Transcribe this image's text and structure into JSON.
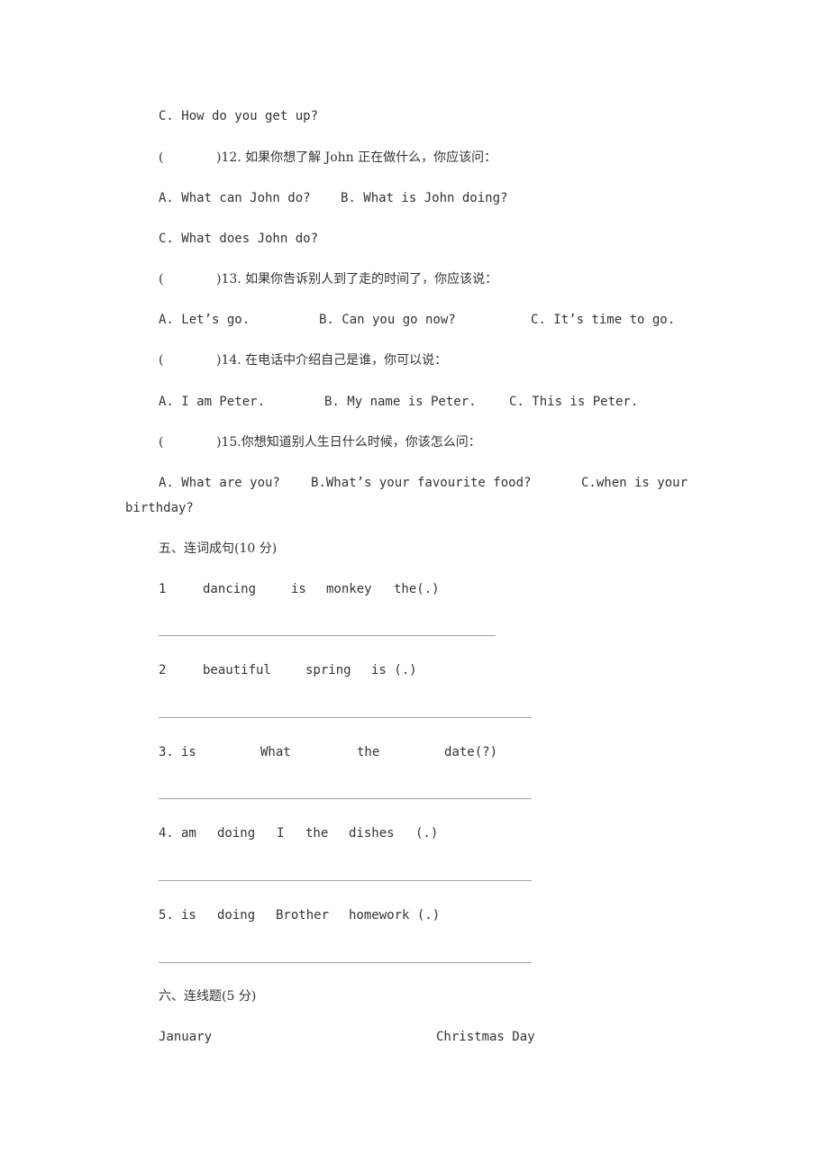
{
  "q11": {
    "option_c": "C. How do you get up?"
  },
  "q12": {
    "bracket_open": "(",
    "stem": ")12. 如果你想了解 John 正在做什么，你应该问：",
    "option_a": "A. What can John do?",
    "option_b": "B. What is John doing?",
    "option_c": "C. What does John do?"
  },
  "q13": {
    "bracket_open": "(",
    "stem": ")13. 如果你告诉别人到了走的时间了，你应该说：",
    "option_a": "A. Let’s go.",
    "option_b": "B. Can you go now?",
    "option_c": "C. It’s time to go."
  },
  "q14": {
    "bracket_open": "(",
    "stem": ")14. 在电话中介绍自己是谁，你可以说：",
    "option_a": "A. I am Peter.",
    "option_b": "B. My name is Peter.",
    "option_c": "C. This is Peter."
  },
  "q15": {
    "bracket_open": "(",
    "stem": ")15.你想知道别人生日什么时候，你该怎么问：",
    "option_a": "A. What are you?",
    "option_b": "B.What’s your favourite food?",
    "option_c_part1": "C.when is your",
    "option_c_part2": "birthday?"
  },
  "section5": {
    "title": "五、连词成句(10 分)",
    "items": [
      {
        "number": "1",
        "words": [
          "dancing",
          "is",
          "monkey",
          "the(.)"
        ]
      },
      {
        "number": "2",
        "words": [
          "beautiful",
          "spring",
          "is (.)"
        ]
      },
      {
        "number": "3.",
        "words": [
          "is",
          "What",
          "the",
          "date(?)"
        ]
      },
      {
        "number": "4.",
        "words": [
          "am",
          "doing",
          "I",
          "the",
          "dishes",
          "(.)"
        ]
      },
      {
        "number": "5.",
        "words": [
          "is",
          "doing",
          "Brother",
          "homework (.)"
        ]
      }
    ]
  },
  "section6": {
    "title": "六、连线题(5 分)",
    "left_item": "January",
    "right_item": "Christmas Day"
  }
}
